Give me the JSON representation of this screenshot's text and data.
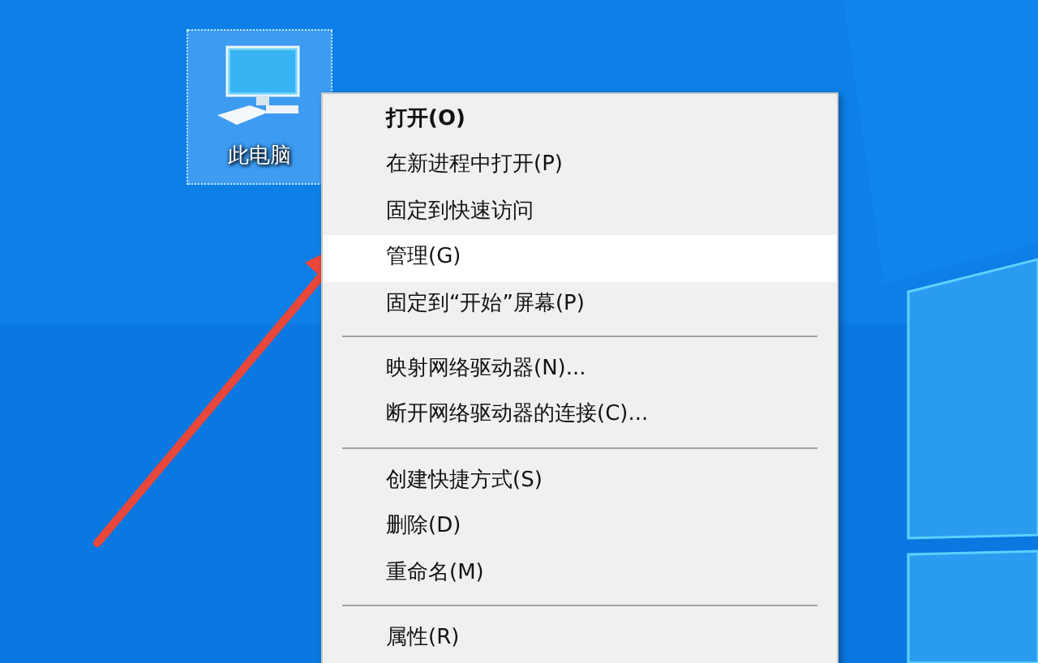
{
  "desktop_icon": {
    "label": "此电脑",
    "selected": true
  },
  "context_menu": [
    {
      "kind": "item",
      "label": "打开(O)",
      "default": true,
      "selected": false
    },
    {
      "kind": "item",
      "label": "在新进程中打开(P)",
      "default": false,
      "selected": false
    },
    {
      "kind": "item",
      "label": "固定到快速访问",
      "default": false,
      "selected": false
    },
    {
      "kind": "item",
      "label": "管理(G)",
      "default": false,
      "selected": true
    },
    {
      "kind": "item",
      "label": "固定到“开始”屏幕(P)",
      "default": false,
      "selected": false
    },
    {
      "kind": "separator"
    },
    {
      "kind": "item",
      "label": "映射网络驱动器(N)...",
      "default": false,
      "selected": false
    },
    {
      "kind": "item",
      "label": "断开网络驱动器的连接(C)...",
      "default": false,
      "selected": false
    },
    {
      "kind": "separator"
    },
    {
      "kind": "item",
      "label": "创建快捷方式(S)",
      "default": false,
      "selected": false
    },
    {
      "kind": "item",
      "label": "删除(D)",
      "default": false,
      "selected": false
    },
    {
      "kind": "item",
      "label": "重命名(M)",
      "default": false,
      "selected": false
    },
    {
      "kind": "separator"
    },
    {
      "kind": "item",
      "label": "属性(R)",
      "default": false,
      "selected": false
    }
  ]
}
